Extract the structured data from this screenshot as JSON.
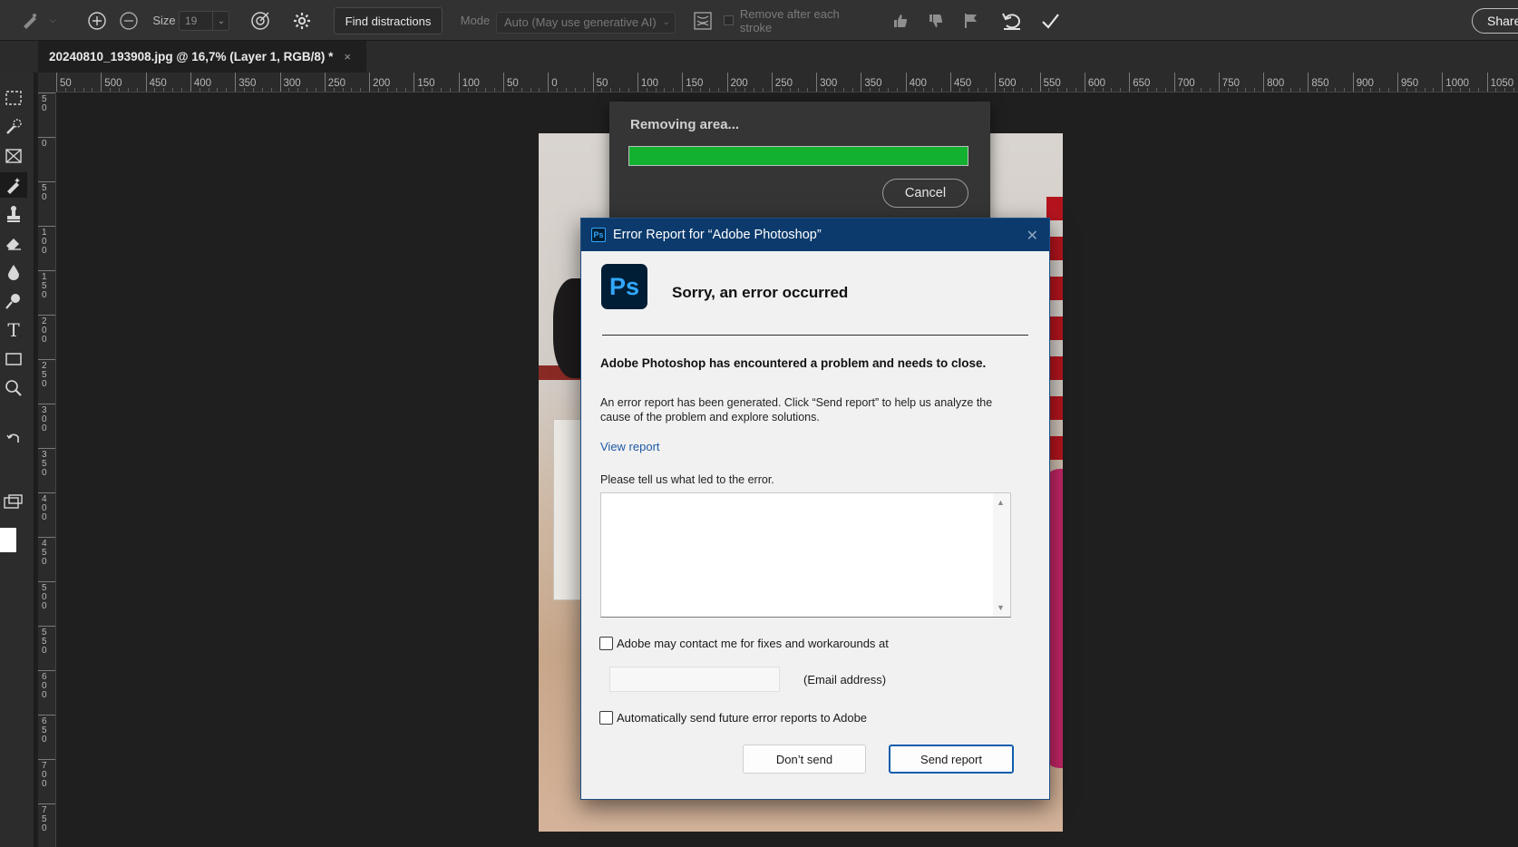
{
  "options_bar": {
    "size_label": "Size",
    "size_value": "19",
    "find_distractions_label": "Find distractions",
    "mode_label": "Mode",
    "mode_value": "Auto (May use generative AI)",
    "remove_after_stroke_label": "Remove after each stroke",
    "share_label": "Share"
  },
  "document_tab": {
    "title": "20240810_193908.jpg @ 16,7% (Layer 1, RGB/8) *",
    "close_glyph": "×"
  },
  "ruler": {
    "horizontal_labels": [
      "50",
      "500",
      "450",
      "400",
      "350",
      "300",
      "250",
      "200",
      "150",
      "100",
      "50",
      "0",
      "50",
      "100",
      "150",
      "200",
      "250",
      "300",
      "350",
      "400",
      "450",
      "500",
      "550",
      "600",
      "650",
      "700",
      "750",
      "800",
      "850",
      "900",
      "950",
      "1000",
      "1050"
    ],
    "vertical_labels": [
      "5 0",
      "0",
      "5 0",
      "1 0 0",
      "1 5 0",
      "2 0 0",
      "2 5 0",
      "3 0 0",
      "3 5 0",
      "4 0 0",
      "4 5 0",
      "5 0 0",
      "5 5 0",
      "6 0 0",
      "6 5 0",
      "7 0 0",
      "7 5 0"
    ]
  },
  "progress_dialog": {
    "title": "Removing area...",
    "progress": 1.0,
    "progress_color": "#12b12f",
    "cancel_label": "Cancel"
  },
  "error_dialog": {
    "window_title": "Error Report for “Adobe Photoshop”",
    "app_badge": "Ps",
    "heading": "Sorry, an error occurred",
    "bold_message": "Adobe Photoshop has encountered a problem and needs to close.",
    "description": "An error report has been generated. Click “Send report” to help us analyze the cause of the problem and explore solutions.",
    "view_report_label": "View report",
    "feedback_prompt": "Please tell us what led to the error.",
    "feedback_value": "",
    "contact_checkbox_label": "Adobe may contact me for fixes and workarounds at",
    "contact_checked": false,
    "email_value": "",
    "email_label": "(Email address)",
    "auto_send_label": "Automatically send future error reports to Adobe",
    "auto_send_checked": false,
    "dont_send_label": "Don’t send",
    "send_report_label": "Send report",
    "accent_color": "#0c3a6c"
  },
  "icons": {
    "options_bar": [
      "healing-brush-icon",
      "add-mode-icon",
      "subtract-mode-icon",
      "target-icon",
      "gear-icon",
      "wires-icon",
      "thumbs-up-icon",
      "thumbs-down-icon",
      "flag-icon",
      "undo-icon",
      "checkmark-icon"
    ],
    "toolbar": [
      "marquee-icon",
      "quick-select-icon",
      "frame-icon",
      "remove-tool-icon",
      "stamp-icon",
      "eraser-icon",
      "blur-icon",
      "dodge-icon",
      "type-icon",
      "rectangle-icon",
      "zoom-icon",
      "swap-colors-icon",
      "screen-mode-icon"
    ]
  }
}
